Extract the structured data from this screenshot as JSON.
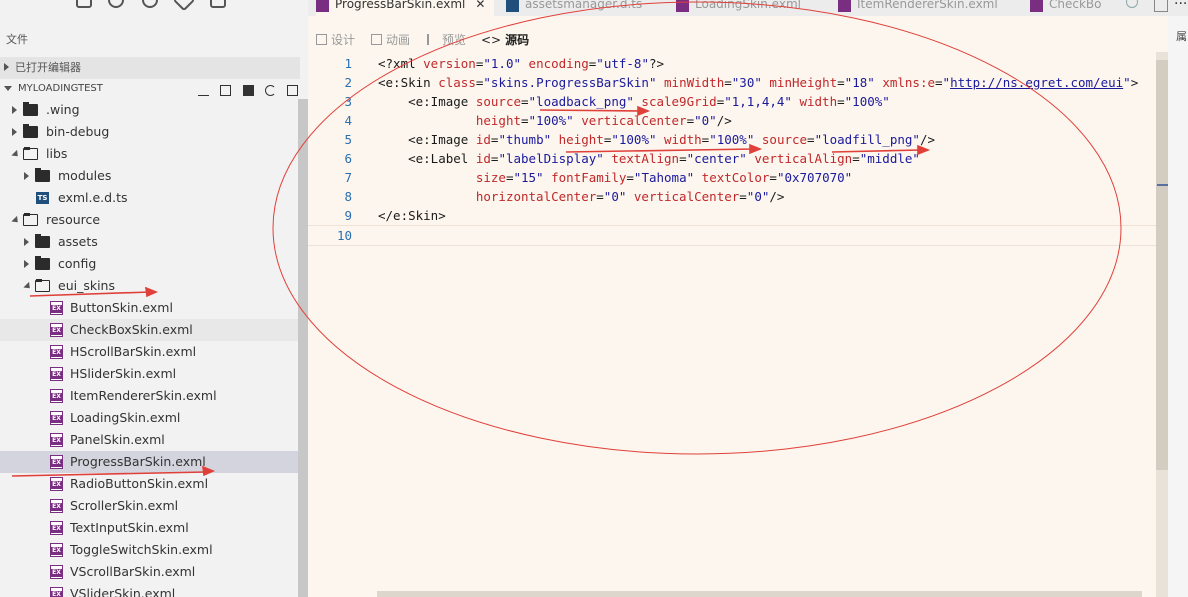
{
  "sidebar": {
    "title": "文件",
    "open_editors_label": "已打开编辑器",
    "project_label": "MYLOADINGTEST",
    "tree": [
      {
        "label": ".wing",
        "kind": "folder",
        "depth": 1,
        "expanded": false
      },
      {
        "label": "bin-debug",
        "kind": "folder",
        "depth": 1,
        "expanded": false
      },
      {
        "label": "libs",
        "kind": "folder",
        "depth": 1,
        "expanded": true
      },
      {
        "label": "modules",
        "kind": "folder",
        "depth": 2,
        "expanded": false
      },
      {
        "label": "exml.e.d.ts",
        "kind": "ts",
        "depth": 2
      },
      {
        "label": "resource",
        "kind": "folder",
        "depth": 1,
        "expanded": true
      },
      {
        "label": "assets",
        "kind": "folder",
        "depth": 2,
        "expanded": false
      },
      {
        "label": "config",
        "kind": "folder",
        "depth": 2,
        "expanded": false
      },
      {
        "label": "eui_skins",
        "kind": "folder",
        "depth": 2,
        "expanded": true
      },
      {
        "label": "ButtonSkin.exml",
        "kind": "exml",
        "depth": 3
      },
      {
        "label": "CheckBoxSkin.exml",
        "kind": "exml",
        "depth": 3,
        "hover": true
      },
      {
        "label": "HScrollBarSkin.exml",
        "kind": "exml",
        "depth": 3
      },
      {
        "label": "HSliderSkin.exml",
        "kind": "exml",
        "depth": 3
      },
      {
        "label": "ItemRendererSkin.exml",
        "kind": "exml",
        "depth": 3
      },
      {
        "label": "LoadingSkin.exml",
        "kind": "exml",
        "depth": 3
      },
      {
        "label": "PanelSkin.exml",
        "kind": "exml",
        "depth": 3
      },
      {
        "label": "ProgressBarSkin.exml",
        "kind": "exml",
        "depth": 3,
        "selected": true
      },
      {
        "label": "RadioButtonSkin.exml",
        "kind": "exml",
        "depth": 3
      },
      {
        "label": "ScrollerSkin.exml",
        "kind": "exml",
        "depth": 3
      },
      {
        "label": "TextInputSkin.exml",
        "kind": "exml",
        "depth": 3
      },
      {
        "label": "ToggleSwitchSkin.exml",
        "kind": "exml",
        "depth": 3
      },
      {
        "label": "VScrollBarSkin.exml",
        "kind": "exml",
        "depth": 3
      },
      {
        "label": "VSliderSkin.exml",
        "kind": "exml",
        "depth": 3
      }
    ]
  },
  "tabs": [
    {
      "label": "ProgressBarSkin.exml",
      "icon": "exml-file-icon",
      "active": true
    },
    {
      "label": "assetsmanager.d.ts",
      "icon": "ts-file-icon",
      "active": false
    },
    {
      "label": "LoadingSkin.exml",
      "icon": "exml-file-icon",
      "active": false
    },
    {
      "label": "ItemRendererSkin.exml",
      "icon": "exml-file-icon",
      "active": false
    },
    {
      "label": "CheckBo",
      "icon": "exml-file-icon",
      "active": false
    }
  ],
  "toolbar": {
    "design": "设计",
    "animation": "动画",
    "preview": "预览",
    "source": "源码"
  },
  "right_panel_label": "属",
  "more_label": "...",
  "code_lines": [
    {
      "n": "1",
      "segs": [
        [
          "tag",
          "<?xml "
        ],
        [
          "attr",
          "version"
        ],
        [
          "tag",
          "="
        ],
        [
          "val",
          "\"1.0\""
        ],
        [
          "tag",
          " "
        ],
        [
          "attr",
          "encoding"
        ],
        [
          "tag",
          "="
        ],
        [
          "val",
          "\"utf-8\""
        ],
        [
          "tag",
          "?>"
        ]
      ]
    },
    {
      "n": "2",
      "segs": [
        [
          "tag",
          "<e:Skin "
        ],
        [
          "attr",
          "class"
        ],
        [
          "tag",
          "="
        ],
        [
          "val",
          "\"skins.ProgressBarSkin\""
        ],
        [
          "tag",
          " "
        ],
        [
          "attr",
          "minWidth"
        ],
        [
          "tag",
          "="
        ],
        [
          "val",
          "\"30\""
        ],
        [
          "tag",
          " "
        ],
        [
          "attr",
          "minHeight"
        ],
        [
          "tag",
          "="
        ],
        [
          "val",
          "\"18\""
        ],
        [
          "tag",
          " "
        ],
        [
          "attr",
          "xmlns:e"
        ],
        [
          "tag",
          "="
        ],
        [
          "val",
          "\""
        ],
        [
          "lnk",
          "http://ns.egret.com/eui"
        ],
        [
          "val",
          "\""
        ],
        [
          "tag",
          ">"
        ]
      ]
    },
    {
      "n": "3",
      "segs": [
        [
          "tag",
          "    <e:Image "
        ],
        [
          "attr",
          "source"
        ],
        [
          "tag",
          "="
        ],
        [
          "val",
          "\"loadback_png\""
        ],
        [
          "tag",
          " "
        ],
        [
          "attr",
          "scale9Grid"
        ],
        [
          "tag",
          "="
        ],
        [
          "val",
          "\"1,1,4,4\""
        ],
        [
          "tag",
          " "
        ],
        [
          "attr",
          "width"
        ],
        [
          "tag",
          "="
        ],
        [
          "val",
          "\"100%\""
        ]
      ]
    },
    {
      "n": "",
      "segs": [
        [
          "tag",
          "             "
        ],
        [
          "attr",
          "height"
        ],
        [
          "tag",
          "="
        ],
        [
          "val",
          "\"100%\""
        ],
        [
          "tag",
          " "
        ],
        [
          "attr",
          "verticalCenter"
        ],
        [
          "tag",
          "="
        ],
        [
          "val",
          "\"0\""
        ],
        [
          "tag",
          "/>"
        ]
      ]
    },
    {
      "n": "5",
      "segs": [
        [
          "tag",
          "    <e:Image "
        ],
        [
          "attr",
          "id"
        ],
        [
          "tag",
          "="
        ],
        [
          "val",
          "\"thumb\""
        ],
        [
          "tag",
          " "
        ],
        [
          "attr",
          "height"
        ],
        [
          "tag",
          "="
        ],
        [
          "val",
          "\"100%\""
        ],
        [
          "tag",
          " "
        ],
        [
          "attr",
          "width"
        ],
        [
          "tag",
          "="
        ],
        [
          "val",
          "\"100%\""
        ],
        [
          "tag",
          " "
        ],
        [
          "attr",
          "source"
        ],
        [
          "tag",
          "="
        ],
        [
          "val",
          "\"loadfill_png\""
        ],
        [
          "tag",
          "/>"
        ]
      ]
    },
    {
      "n": "6",
      "segs": [
        [
          "tag",
          "    <e:Label "
        ],
        [
          "attr",
          "id"
        ],
        [
          "tag",
          "="
        ],
        [
          "val",
          "\"labelDisplay\""
        ],
        [
          "tag",
          " "
        ],
        [
          "attr",
          "textAlign"
        ],
        [
          "tag",
          "="
        ],
        [
          "val",
          "\"center\""
        ],
        [
          "tag",
          " "
        ],
        [
          "attr",
          "verticalAlign"
        ],
        [
          "tag",
          "="
        ],
        [
          "val",
          "\"middle\""
        ]
      ]
    },
    {
      "n": "7",
      "segs": [
        [
          "tag",
          "             "
        ],
        [
          "attr",
          "size"
        ],
        [
          "tag",
          "="
        ],
        [
          "val",
          "\"15\""
        ],
        [
          "tag",
          " "
        ],
        [
          "attr",
          "fontFamily"
        ],
        [
          "tag",
          "="
        ],
        [
          "val",
          "\"Tahoma\""
        ],
        [
          "tag",
          " "
        ],
        [
          "attr",
          "textColor"
        ],
        [
          "tag",
          "="
        ],
        [
          "val",
          "\"0x707070\""
        ]
      ]
    },
    {
      "n": "8",
      "segs": [
        [
          "tag",
          "             "
        ],
        [
          "attr",
          "horizontalCenter"
        ],
        [
          "tag",
          "="
        ],
        [
          "val",
          "\"0\""
        ],
        [
          "tag",
          " "
        ],
        [
          "attr",
          "verticalCenter"
        ],
        [
          "tag",
          "="
        ],
        [
          "val",
          "\"0\""
        ],
        [
          "tag",
          "/>"
        ]
      ]
    },
    {
      "n": "9",
      "segs": [
        [
          "tag",
          "</e:Skin>"
        ]
      ]
    },
    {
      "n": "10",
      "segs": []
    }
  ],
  "colors": {
    "annotation": "#e0403a",
    "selected_row": "#d4d4de",
    "editor_bg": "#fdf6ee"
  }
}
